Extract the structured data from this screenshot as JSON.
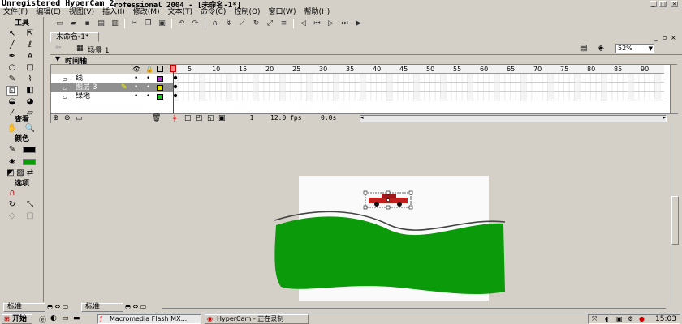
{
  "window": {
    "watermark": "Unregistered HyperCam 2",
    "title_rest": "rofessional 2004 - [未命名-1*]"
  },
  "menu": [
    "文件(F)",
    "编辑(E)",
    "视图(V)",
    "插入(I)",
    "修改(M)",
    "文本(T)",
    "命令(C)",
    "控制(O)",
    "窗口(W)",
    "帮助(H)"
  ],
  "tools": {
    "header": "工具",
    "view_header": "查看",
    "color_header": "颜色",
    "options_header": "选项"
  },
  "document": {
    "tab": "未命名-1*",
    "scene": "场景 1",
    "zoom": "52%"
  },
  "timeline": {
    "title": "时间轴",
    "ruler": [
      "5",
      "10",
      "15",
      "20",
      "25",
      "30",
      "35",
      "40",
      "45",
      "50",
      "55",
      "60",
      "65",
      "70",
      "75",
      "80",
      "85",
      "90"
    ],
    "layers": [
      {
        "name": "线"
      },
      {
        "name": "图层 3"
      },
      {
        "name": "绿地"
      }
    ],
    "frame": "1",
    "fps": "12.0 fps",
    "time": "0.0s"
  },
  "bottom_panels": [
    "标准",
    "标准"
  ],
  "taskbar": {
    "start": "开始",
    "tasks": [
      "Macromedia Flash MX...",
      "HyperCam - 正在录制"
    ],
    "clock": "15:03"
  },
  "colors": {
    "chrome": "#d4d0c8",
    "grass": "#0a9a0a",
    "canvas": "#fafafa"
  }
}
